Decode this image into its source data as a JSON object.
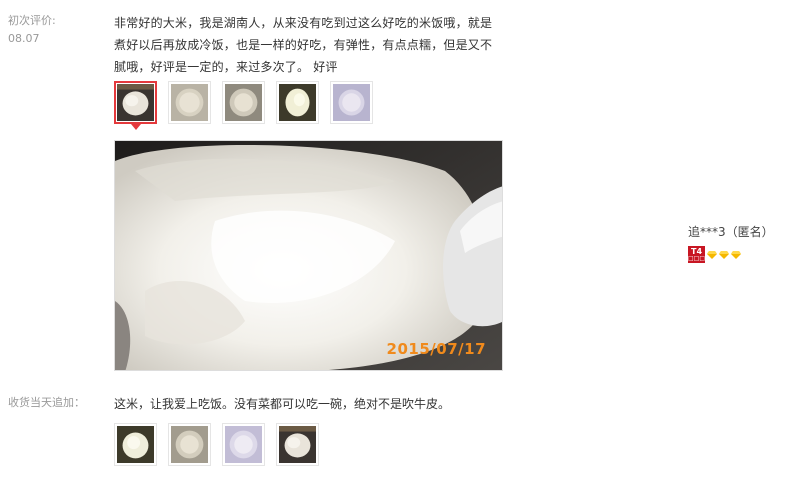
{
  "initial": {
    "label": "初次评价:",
    "date": "08.07",
    "text": "非常好的大米，我是湖南人，从来没有吃到过这么好吃的米饭哦，就是煮好以后再放成冷饭，也是一样的好吃，有弹性，有点点糯，但是又不腻哦，好评是一定的，来过多次了。 好评",
    "photo_timestamp": "2015/07/17"
  },
  "reviewer": {
    "name": "追***3（匿名）",
    "level_badge": "T4",
    "level_badge_sub": "□□□",
    "diamond_color": "#f5b800",
    "badge_color": "#c81623"
  },
  "append": {
    "label": "收货当天追加：",
    "text": "这米，让我爱上吃饭。没有菜都可以吃一碗，绝对不是吹牛皮。"
  },
  "colors": {
    "selected_border": "#e4393c",
    "timestamp": "#f08a1c"
  }
}
